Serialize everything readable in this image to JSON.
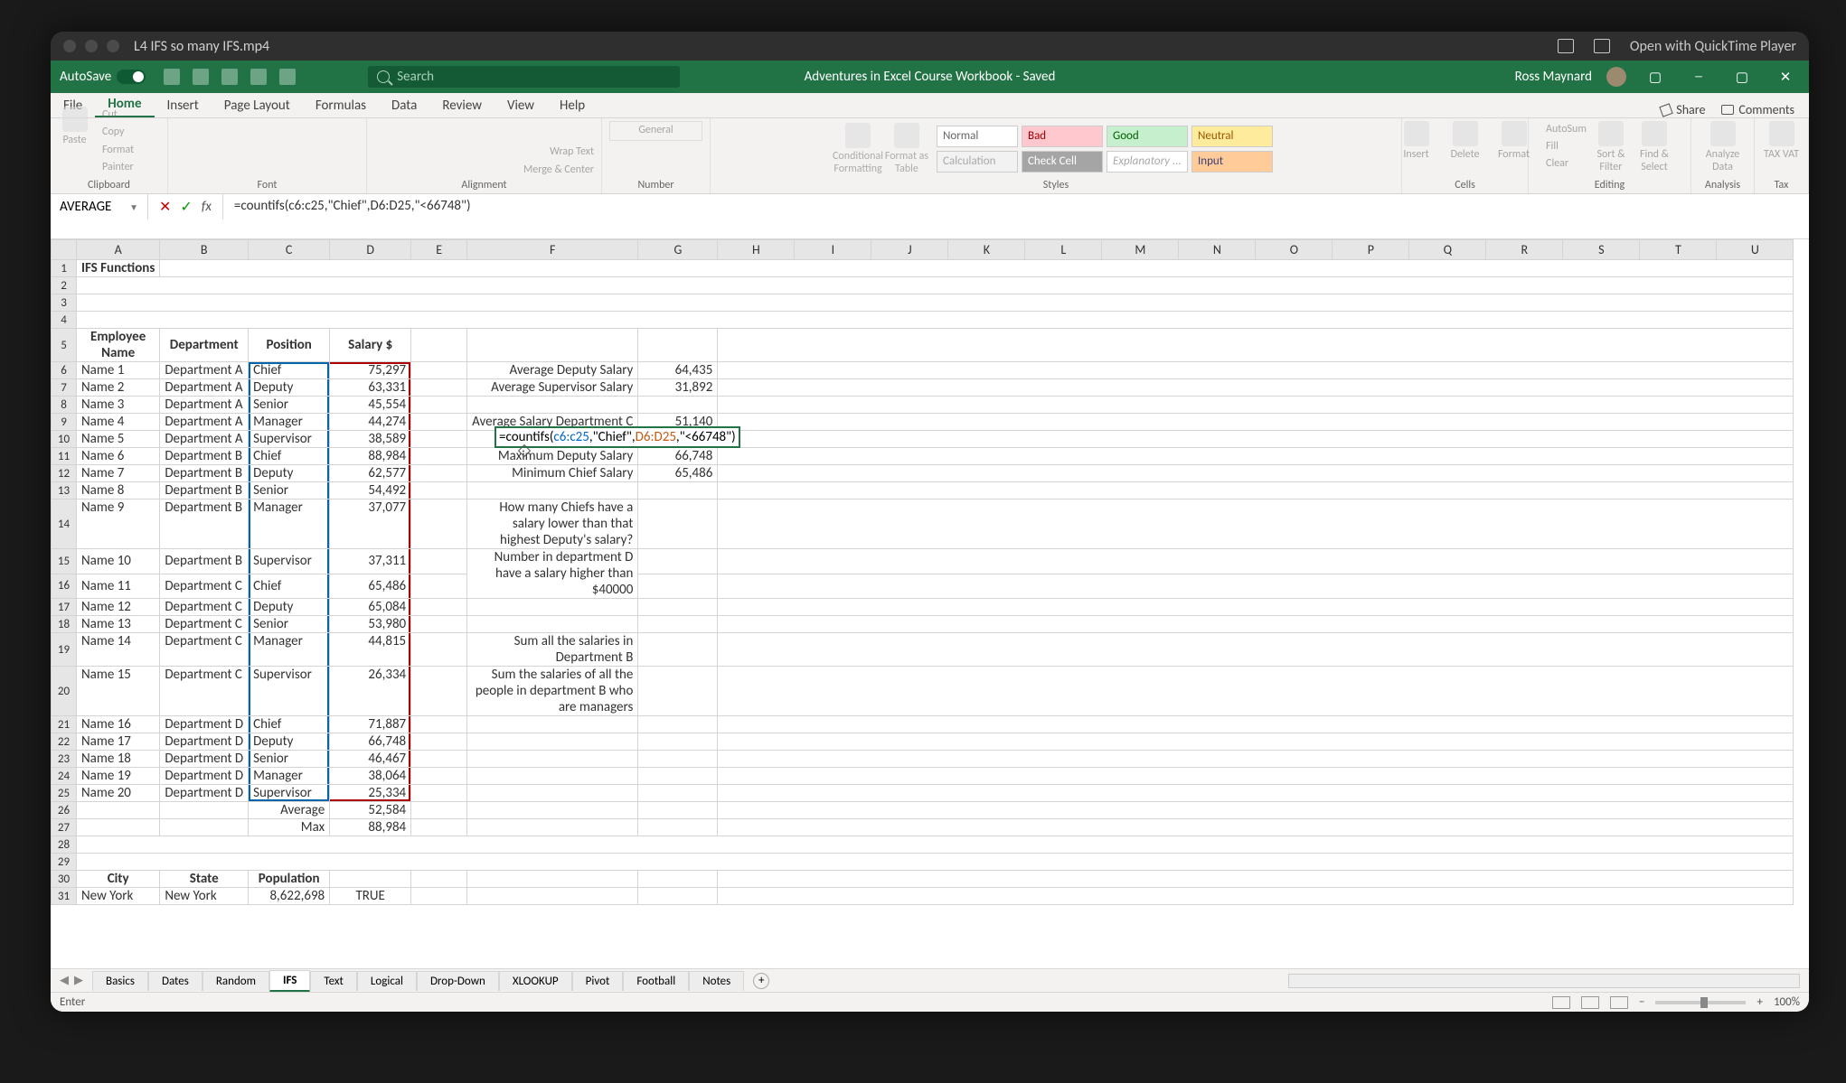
{
  "macTitle": "L4 IFS so many IFS.mp4",
  "macOpen": "Open with QuickTime Player",
  "xlTitlebar": {
    "autosave": "AutoSave",
    "docTitle": "Adventures in Excel Course Workbook - Saved",
    "search": "Search",
    "user": "Ross Maynard"
  },
  "ribbonTabs": [
    "File",
    "Home",
    "Insert",
    "Page Layout",
    "Formulas",
    "Data",
    "Review",
    "View",
    "Help"
  ],
  "activeTab": "Home",
  "ribbonRight": {
    "share": "Share",
    "comments": "Comments"
  },
  "ribbonGroups": {
    "clipboard": {
      "label": "Clipboard",
      "paste": "Paste",
      "cut": "Cut",
      "copy": "Copy",
      "format": "Format Painter"
    },
    "font": {
      "label": "Font"
    },
    "alignment": {
      "label": "Alignment",
      "wrap": "Wrap Text",
      "merge": "Merge & Center"
    },
    "number": {
      "label": "Number",
      "style": "General"
    },
    "styles": {
      "label": "Styles",
      "cond": "Conditional Formatting",
      "fmt": "Format as Table",
      "gallery": [
        "Normal",
        "Bad",
        "Good",
        "Neutral",
        "Calculation",
        "Check Cell",
        "Explanatory ...",
        "Input"
      ]
    },
    "cells": {
      "label": "Cells",
      "insert": "Insert",
      "delete": "Delete",
      "format": "Format"
    },
    "editing": {
      "label": "Editing",
      "autosum": "AutoSum",
      "fill": "Fill",
      "clear": "Clear",
      "sort": "Sort & Filter",
      "find": "Find & Select"
    },
    "analysis": {
      "label": "Analysis",
      "analyze": "Analyze Data"
    },
    "tax": {
      "label": "Tax",
      "btn": "TAX VAT"
    }
  },
  "nameBox": "AVERAGE",
  "formula": "=countifs(c6:c25,\"Chief\",D6:D25,\"<66748\")",
  "cols": [
    "A",
    "B",
    "C",
    "D",
    "E",
    "F",
    "G",
    "H",
    "I",
    "J",
    "K",
    "L",
    "M",
    "N",
    "O",
    "P",
    "Q",
    "R",
    "S",
    "T",
    "U"
  ],
  "sheet": {
    "a1": "IFS Functions",
    "headers5": {
      "a": "Employee Name",
      "b": "Department",
      "c": "Position",
      "d": "Salary $"
    },
    "rows": [
      {
        "r": 6,
        "a": "Name 1",
        "b": "Department A",
        "c": "Chief",
        "d": "75,297"
      },
      {
        "r": 7,
        "a": "Name 2",
        "b": "Department A",
        "c": "Deputy",
        "d": "63,331"
      },
      {
        "r": 8,
        "a": "Name 3",
        "b": "Department A",
        "c": "Senior",
        "d": "45,554"
      },
      {
        "r": 9,
        "a": "Name 4",
        "b": "Department A",
        "c": "Manager",
        "d": "44,274"
      },
      {
        "r": 10,
        "a": "Name 5",
        "b": "Department A",
        "c": "Supervisor",
        "d": "38,589"
      },
      {
        "r": 11,
        "a": "Name 6",
        "b": "Department B",
        "c": "Chief",
        "d": "88,984"
      },
      {
        "r": 12,
        "a": "Name 7",
        "b": "Department B",
        "c": "Deputy",
        "d": "62,577"
      },
      {
        "r": 13,
        "a": "Name 8",
        "b": "Department B",
        "c": "Senior",
        "d": "54,492"
      },
      {
        "r": 14,
        "a": "Name 9",
        "b": "Department B",
        "c": "Manager",
        "d": "37,077"
      },
      {
        "r": 15,
        "a": "Name 10",
        "b": "Department B",
        "c": "Supervisor",
        "d": "37,311"
      },
      {
        "r": 16,
        "a": "Name 11",
        "b": "Department C",
        "c": "Chief",
        "d": "65,486"
      },
      {
        "r": 17,
        "a": "Name 12",
        "b": "Department C",
        "c": "Deputy",
        "d": "65,084"
      },
      {
        "r": 18,
        "a": "Name 13",
        "b": "Department C",
        "c": "Senior",
        "d": "53,980"
      },
      {
        "r": 19,
        "a": "Name 14",
        "b": "Department C",
        "c": "Manager",
        "d": "44,815"
      },
      {
        "r": 20,
        "a": "Name 15",
        "b": "Department C",
        "c": "Supervisor",
        "d": "26,334"
      },
      {
        "r": 21,
        "a": "Name 16",
        "b": "Department D",
        "c": "Chief",
        "d": "71,887"
      },
      {
        "r": 22,
        "a": "Name 17",
        "b": "Department D",
        "c": "Deputy",
        "d": "66,748"
      },
      {
        "r": 23,
        "a": "Name 18",
        "b": "Department D",
        "c": "Senior",
        "d": "46,467"
      },
      {
        "r": 24,
        "a": "Name 19",
        "b": "Department D",
        "c": "Manager",
        "d": "38,064"
      },
      {
        "r": 25,
        "a": "Name 20",
        "b": "Department D",
        "c": "Supervisor",
        "d": "25,334"
      }
    ],
    "row26c": "Average",
    "row26d": "52,584",
    "row27c": "Max",
    "row27d": "88,984",
    "labels": {
      "f6": "Average Deputy Salary",
      "g6": "64,435",
      "f7": "Average Supervisor Salary",
      "g7": "31,892",
      "f9": "Average  Salary Department C",
      "g9": "51,140",
      "f11": "Maximum Deputy Salary",
      "g11": "66,748",
      "f12": "Minimum Chief Salary",
      "g12": "65,486",
      "f14": "How many Chiefs have a salary lower than that highest Deputy's salary?",
      "f15": "Number in department D have a salary higher than $40000",
      "f19": "Sum all the salaries in Department B",
      "f20": "Sum the salaries of all the people in department B who are managers"
    },
    "row30": {
      "a": "City",
      "b": "State",
      "c": "Population"
    },
    "row31": {
      "a": "New York",
      "b": "New York",
      "c": "8,622,698",
      "d": "TRUE"
    },
    "editCell": "=countifs(c6:c25,\"Chief\",D6:D25,\"<66748\")"
  },
  "sheetTabs": [
    "Basics",
    "Dates",
    "Random",
    "IFS",
    "Text",
    "Logical",
    "Drop-Down",
    "XLOOKUP",
    "Pivot",
    "Football",
    "Notes"
  ],
  "activeSheet": "IFS",
  "statusLeft": "Enter",
  "zoom": "100%"
}
